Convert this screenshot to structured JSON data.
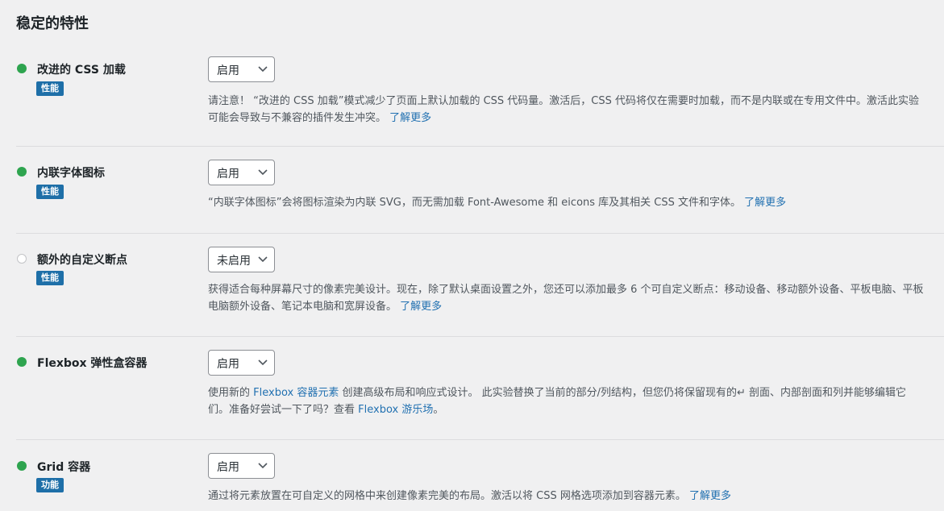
{
  "section_title": "稳定的特性",
  "features": [
    {
      "name": "改进的 CSS 加载",
      "enabled": true,
      "tag": "性能",
      "select_value": "启用",
      "desc": "请注意！ “改进的 CSS 加载”模式减少了页面上默认加载的 CSS 代码量。激活后，CSS 代码将仅在需要时加载，而不是内联或在专用文件中。激活此实验可能会导致与不兼容的插件发生冲突。",
      "link": "了解更多"
    },
    {
      "name": "内联字体图标",
      "enabled": true,
      "tag": "性能",
      "select_value": "启用",
      "desc": "“内联字体图标”会将图标渲染为内联 SVG，而无需加载 Font-Awesome 和 eicons 库及其相关 CSS 文件和字体。",
      "link": "了解更多"
    },
    {
      "name": "额外的自定义断点",
      "enabled": false,
      "tag": "性能",
      "select_value": "未启用",
      "desc": "获得适合每种屏幕尺寸的像素完美设计。现在，除了默认桌面设置之外，您还可以添加最多 6 个可自定义断点：移动设备、移动额外设备、平板电脑、平板电脑额外设备、笔记本电脑和宽屏设备。",
      "link": "了解更多"
    },
    {
      "name": "Flexbox 弹性盒容器",
      "enabled": true,
      "select_value": "启用",
      "desc_parts": [
        "使用新的 ",
        "Flexbox 容器元素",
        " 创建高级布局和响应式设计。 此实验替换了当前的部分/列结构，但您仍将保留现有的↵ 剖面、内部剖面和列并能够编辑它们。准备好尝试一下了吗？查看 ",
        "Flexbox 游乐场",
        "。"
      ]
    },
    {
      "name": "Grid 容器",
      "enabled": true,
      "tag": "功能",
      "select_value": "启用",
      "desc": "通过将元素放置在可自定义的网格中来创建像素完美的布局。激活以将 CSS 网格选项添加到容器元素。",
      "link": "了解更多"
    }
  ]
}
